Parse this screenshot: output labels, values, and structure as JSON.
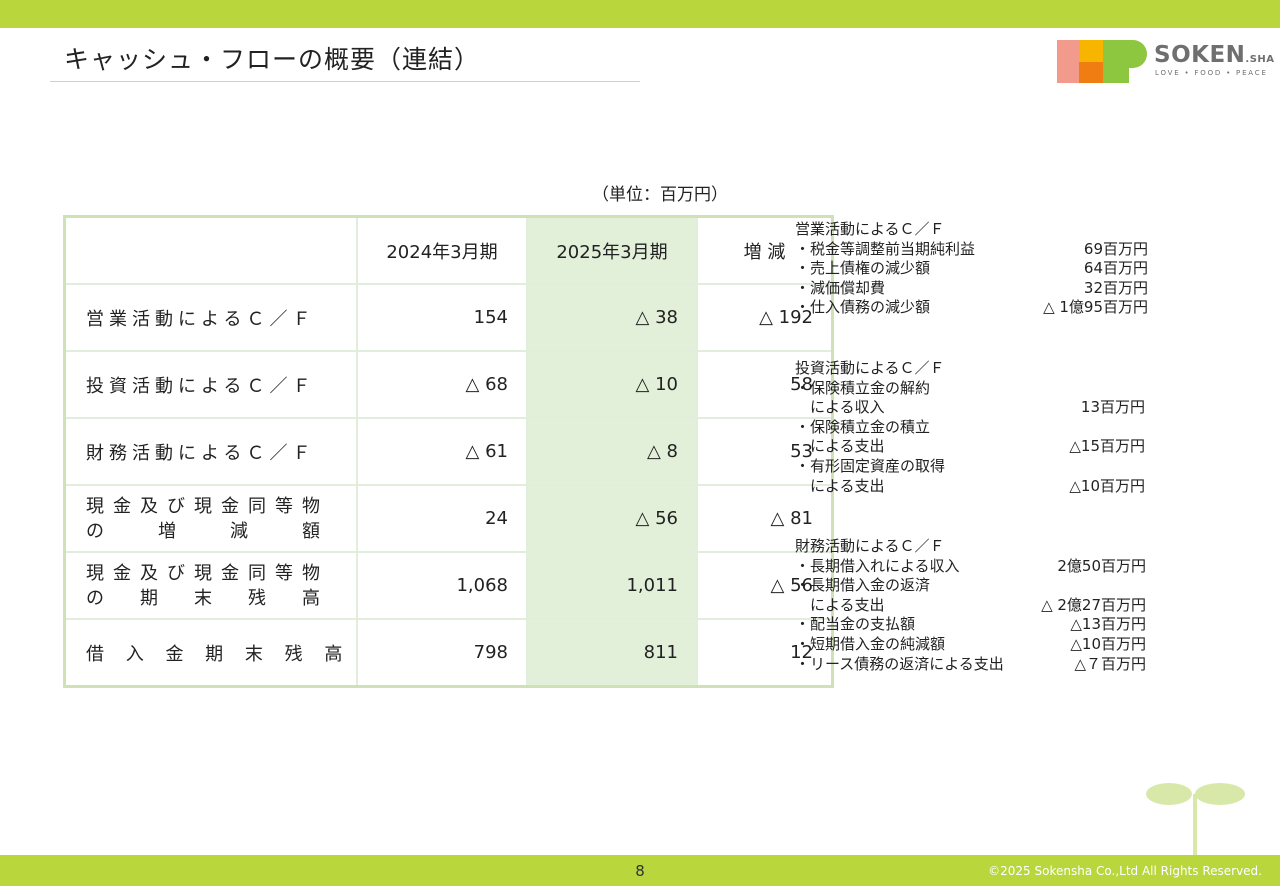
{
  "title": "キャッシュ・フローの概要（連結）",
  "logo": {
    "name": "SOKEN",
    "suffix": ".SHA",
    "tagline": "LOVE • FOOD • PEACE"
  },
  "unit": "（単位：百万円）",
  "table": {
    "headers": [
      "",
      "2024年3月期",
      "2025年3月期",
      "増 減"
    ],
    "rows": [
      {
        "label": "営業活動によるＣ／Ｆ",
        "v2024": "154",
        "v2025": "△ 38",
        "change": "△ 192"
      },
      {
        "label": "投資活動によるＣ／Ｆ",
        "v2024": "△ 68",
        "v2025": "△ 10",
        "change": "58"
      },
      {
        "label": "財務活動によるＣ／Ｆ",
        "v2024": "△ 61",
        "v2025": "△ 8",
        "change": "53"
      },
      {
        "label_line1": [
          "現",
          "金",
          "及",
          "び",
          "現",
          "金",
          "同",
          "等",
          "物"
        ],
        "label_line2": [
          "の",
          "増",
          "減",
          "額"
        ],
        "v2024": "24",
        "v2025": "△ 56",
        "change": "△ 81"
      },
      {
        "label_line1": [
          "現",
          "金",
          "及",
          "び",
          "現",
          "金",
          "同",
          "等",
          "物"
        ],
        "label_line2": [
          "の",
          "期",
          "末",
          "残",
          "高"
        ],
        "v2024": "1,068",
        "v2025": "1,011",
        "change": "△ 56"
      },
      {
        "label": "借 入 金 期 末 残 高",
        "v2024": "798",
        "v2025": "811",
        "change": "12"
      }
    ]
  },
  "notes": {
    "operating": {
      "heading": "営業活動によるＣ／Ｆ",
      "items": [
        {
          "label": "・税金等調整前当期純利益",
          "amount": "69百万円"
        },
        {
          "label": "・売上債権の減少額",
          "amount": "64百万円"
        },
        {
          "label": "・減価償却費",
          "amount": "32百万円"
        },
        {
          "label": "・仕入債務の減少額",
          "amount": "△ 1億95百万円"
        }
      ]
    },
    "investing": {
      "heading": "投資活動によるＣ／Ｆ",
      "items": [
        {
          "label": "・保険積立金の解約",
          "amount": ""
        },
        {
          "label": "　による収入",
          "amount": "13百万円"
        },
        {
          "label": "・保険積立金の積立",
          "amount": ""
        },
        {
          "label": "　による支出",
          "amount": "△15百万円"
        },
        {
          "label": "・有形固定資産の取得",
          "amount": ""
        },
        {
          "label": "　による支出",
          "amount": "△10百万円"
        }
      ]
    },
    "financing": {
      "heading": "財務活動によるＣ／Ｆ",
      "items": [
        {
          "label": "・長期借入れによる収入",
          "amount": "2億50百万円"
        },
        {
          "label": "・長期借入金の返済",
          "amount": ""
        },
        {
          "label": "　による支出",
          "amount": "△ 2億27百万円"
        },
        {
          "label": "・配当金の支払額",
          "amount": "△13百万円"
        },
        {
          "label": "・短期借入金の純減額",
          "amount": "△10百万円"
        },
        {
          "label": "・リース債務の返済による支出",
          "amount": "△７百万円"
        }
      ]
    }
  },
  "footer": {
    "page": "8",
    "copyright": "©2025 Sokensha Co.,Ltd All Rights Reserved."
  },
  "colors": {
    "band": "#b9d63d",
    "highlight": "#e2efd9",
    "sprout": "#d8e8a8"
  }
}
